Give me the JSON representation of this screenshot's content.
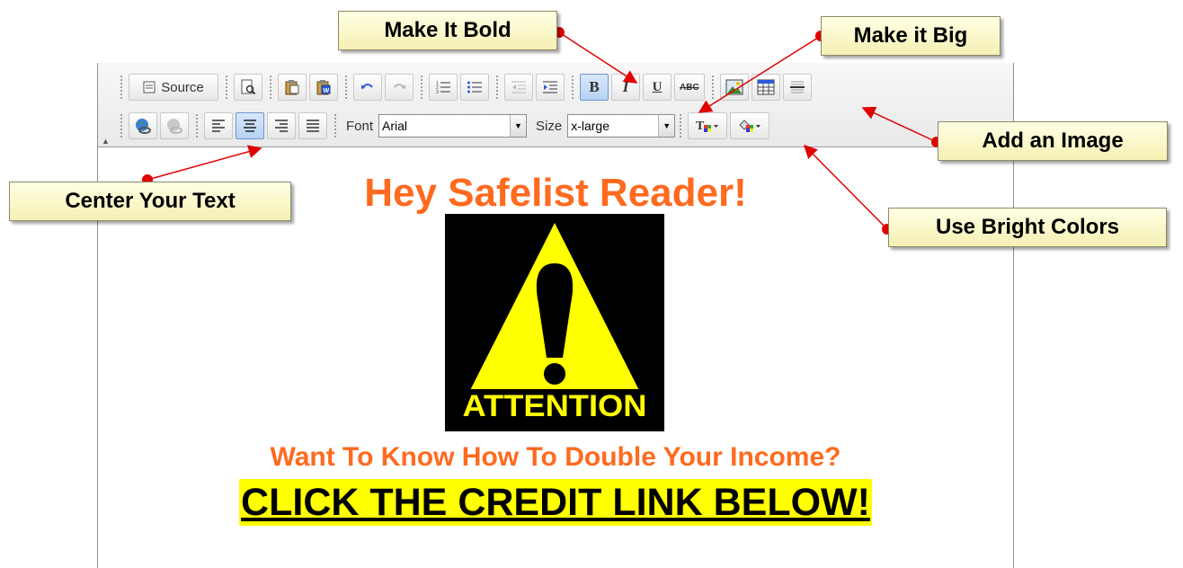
{
  "toolbar": {
    "source_label": "Source",
    "font_label": "Font",
    "font_value": "Arial",
    "size_label": "Size",
    "size_value": "x-large",
    "bold_glyph": "B",
    "italic_glyph": "I",
    "underline_glyph": "U",
    "strike_glyph": "ABC",
    "row1_icons": [
      "source-icon",
      "preview-icon",
      "paste-text-icon",
      "paste-word-icon",
      "undo-icon",
      "redo-icon",
      "numbered-list-icon",
      "bulleted-list-icon",
      "outdent-icon",
      "indent-icon",
      "bold-icon",
      "italic-icon",
      "underline-icon",
      "strikethrough-icon",
      "image-icon",
      "table-icon",
      "horizontal-rule-icon"
    ],
    "row2_icons": [
      "link-icon",
      "unlink-icon",
      "align-left-icon",
      "align-center-icon",
      "align-right-icon",
      "justify-icon",
      "text-color-icon",
      "background-color-icon"
    ]
  },
  "content": {
    "headline": "Hey Safelist Reader!",
    "attention_text": "ATTENTION",
    "subheadline": "Want To Know How To Double Your Income?",
    "cta": "CLICK THE CREDIT LINK BELOW!"
  },
  "callouts": {
    "bold": "Make It Bold",
    "big": "Make it Big",
    "image": "Add an Image",
    "colors": "Use Bright Colors",
    "center": "Center Your Text"
  },
  "colors": {
    "headline": "#ff6a1f",
    "cta_highlight": "#ffff00",
    "attention_yellow": "#ffff00",
    "callout_bg": "#ffffe4",
    "arrow": "#e00000"
  }
}
